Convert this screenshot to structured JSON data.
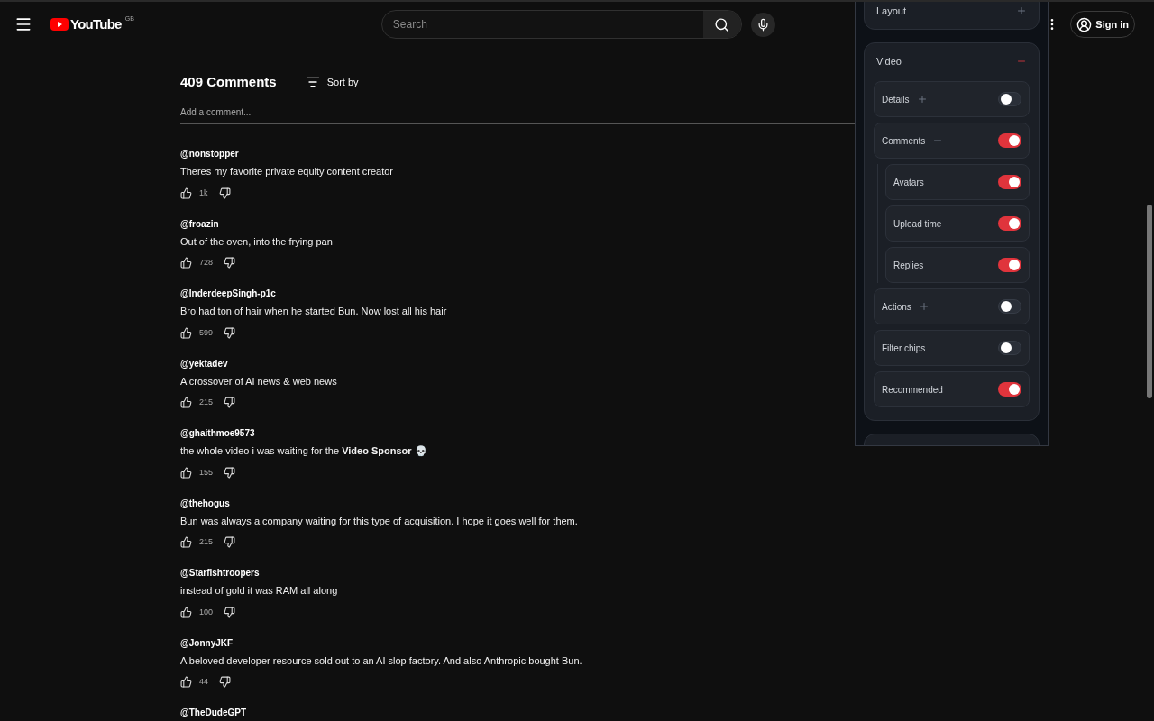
{
  "header": {
    "logo": "YouTube",
    "region": "GB",
    "search": {
      "placeholder": "Search"
    },
    "sign_in": "Sign in"
  },
  "comments_header": {
    "count": "409 Comments",
    "sort": "Sort by",
    "add_placeholder": "Add a comment..."
  },
  "comments": [
    {
      "author": "@nonstopper",
      "text": "Theres my favorite private equity content creator",
      "likes": "1k"
    },
    {
      "author": "@froazin",
      "text": "Out of the oven, into the frying pan",
      "likes": "728"
    },
    {
      "author": "@InderdeepSingh-p1c",
      "text": "Bro had ton of hair when he started Bun. Now lost all his hair",
      "likes": "599"
    },
    {
      "author": "@yektadev",
      "text": "A crossover of AI news & web news",
      "likes": "215"
    },
    {
      "author": "@ghaithmoe9573",
      "text": "the whole video i was waiting for the **Video Sponsor** 💀",
      "likes": "155"
    },
    {
      "author": "@thehogus",
      "text": "Bun was always a company waiting for this type of acquisition. I hope it goes well for them.",
      "likes": "215"
    },
    {
      "author": "@Starfishtroopers",
      "text": "instead of gold it was RAM all along",
      "likes": "100"
    },
    {
      "author": "@JonnyJKF",
      "text": "A beloved developer resource sold out to an AI slop factory. And also Anthropic bought Bun.",
      "likes": "44"
    },
    {
      "author": "@TheDudeGPT"
    }
  ],
  "panel": {
    "sections": [
      {
        "title": "Layout",
        "expanded": false
      },
      {
        "title": "Video",
        "expanded": true,
        "items": [
          {
            "label": "Details",
            "expanded": false,
            "on": false
          },
          {
            "label": "Comments",
            "expanded": true,
            "on": true,
            "children": [
              {
                "label": "Avatars",
                "on": true
              },
              {
                "label": "Upload time",
                "on": true
              },
              {
                "label": "Replies",
                "on": true
              }
            ]
          },
          {
            "label": "Actions",
            "expanded": false,
            "on": false
          },
          {
            "label": "Filter chips",
            "on": false
          },
          {
            "label": "Recommended",
            "on": true
          }
        ]
      }
    ]
  }
}
